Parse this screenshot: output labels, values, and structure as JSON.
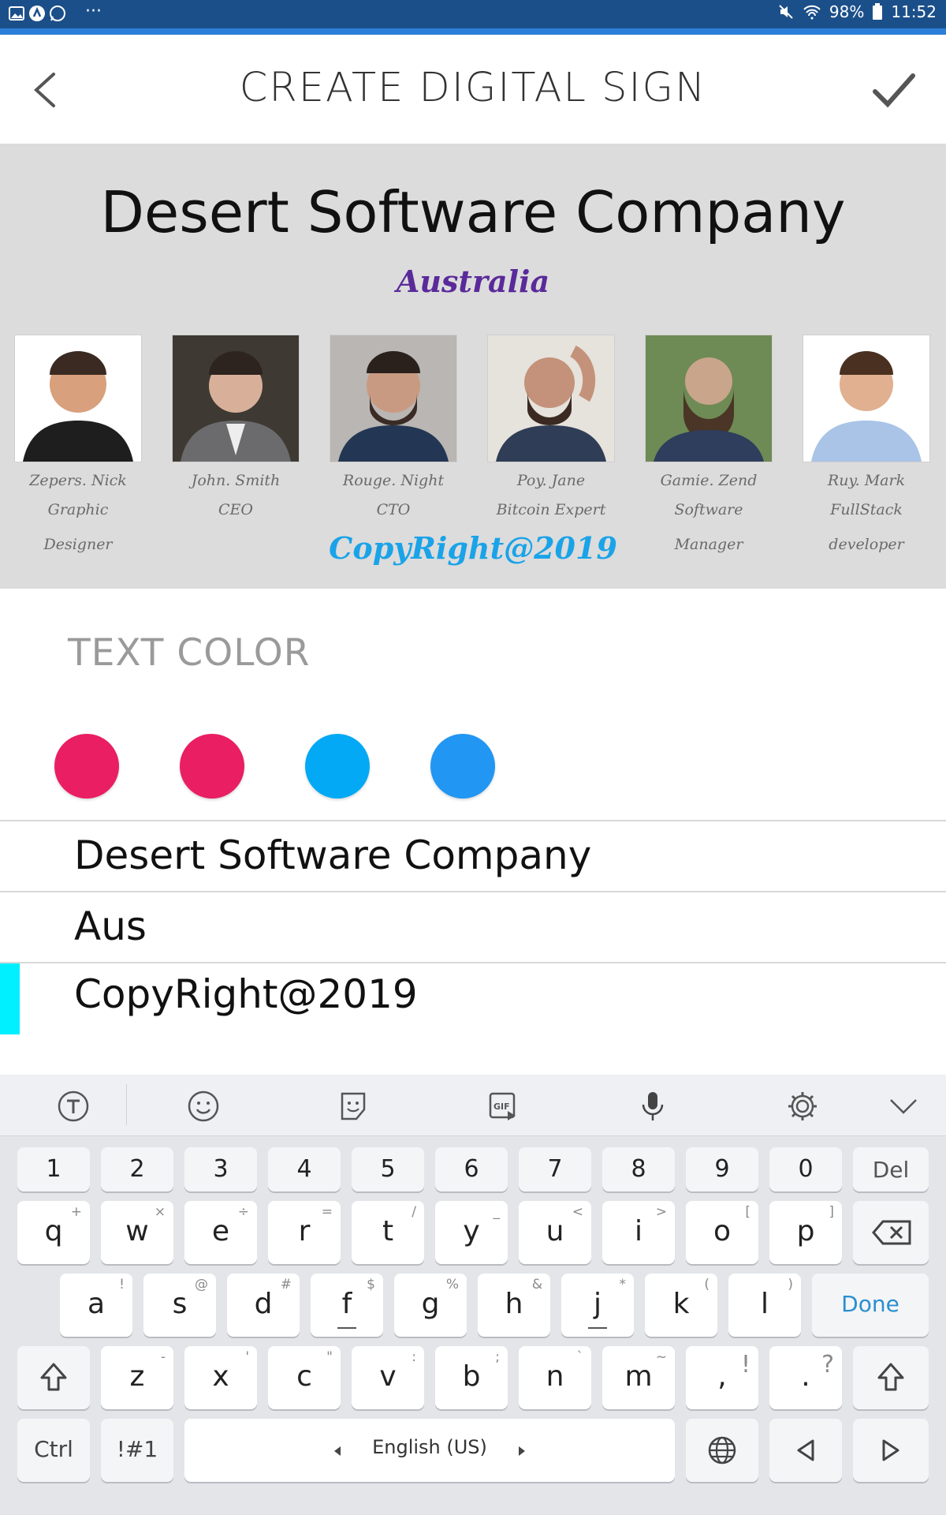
{
  "status_bar": {
    "battery": "98%",
    "time": "11:52",
    "more": "···"
  },
  "header": {
    "title": "CREATE DIGITAL SIGN"
  },
  "preview": {
    "title": "Desert Software Company",
    "subtitle": "Australia",
    "footer": "CopyRight@2019",
    "people": [
      {
        "name": "Zepers. Nick",
        "role": "Graphic Designer"
      },
      {
        "name": "John. Smith",
        "role": "CEO"
      },
      {
        "name": "Rouge. Night",
        "role": "CTO"
      },
      {
        "name": "Poy. Jane",
        "role": "Bitcoin Expert"
      },
      {
        "name": "Gamie. Zend",
        "role": "Software Manager"
      },
      {
        "name": "Ruy. Mark",
        "role": "FullStack developer"
      }
    ]
  },
  "text_color": {
    "label": "TEXT COLOR",
    "swatches": [
      "#e91e63",
      "#e91e63",
      "#03a9f4",
      "#2196f3"
    ]
  },
  "fields": [
    {
      "value": "Desert Software Company"
    },
    {
      "value": "Aus"
    },
    {
      "value": "CopyRight@2019"
    }
  ],
  "keyboard": {
    "number_row": [
      "1",
      "2",
      "3",
      "4",
      "5",
      "6",
      "7",
      "8",
      "9",
      "0"
    ],
    "del": "Del",
    "row1": [
      {
        "k": "q",
        "s": "+"
      },
      {
        "k": "w",
        "s": "×"
      },
      {
        "k": "e",
        "s": "÷"
      },
      {
        "k": "r",
        "s": "="
      },
      {
        "k": "t",
        "s": "/"
      },
      {
        "k": "y",
        "s": "_"
      },
      {
        "k": "u",
        "s": "<"
      },
      {
        "k": "i",
        "s": ">"
      },
      {
        "k": "o",
        "s": "["
      },
      {
        "k": "p",
        "s": "]"
      }
    ],
    "row2": [
      {
        "k": "a",
        "s": "!"
      },
      {
        "k": "s",
        "s": "@"
      },
      {
        "k": "d",
        "s": "#"
      },
      {
        "k": "f",
        "s": "$"
      },
      {
        "k": "g",
        "s": "%"
      },
      {
        "k": "h",
        "s": "&"
      },
      {
        "k": "j",
        "s": "*"
      },
      {
        "k": "k",
        "s": "("
      },
      {
        "k": "l",
        "s": ")"
      }
    ],
    "done": "Done",
    "row3": [
      {
        "k": "z",
        "s": "-"
      },
      {
        "k": "x",
        "s": "'"
      },
      {
        "k": "c",
        "s": "\""
      },
      {
        "k": "v",
        "s": ":"
      },
      {
        "k": "b",
        "s": ";"
      },
      {
        "k": "n",
        "s": "`"
      },
      {
        "k": "m",
        "s": "~"
      },
      {
        "k": ",",
        "s": "!"
      },
      {
        "k": ".",
        "s": "?"
      }
    ],
    "ctrl": "Ctrl",
    "symbols": "!#1",
    "language": "English (US)"
  }
}
